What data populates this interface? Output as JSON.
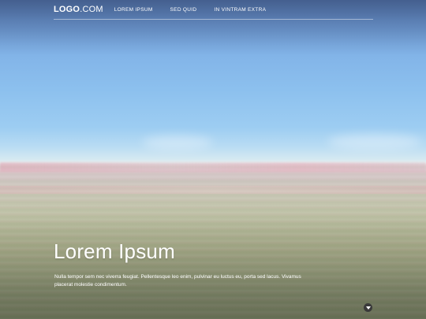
{
  "nav": {
    "logo_bold": "LOGO",
    "logo_light": ".COM",
    "items": [
      {
        "label": "LOREM IPSUM"
      },
      {
        "label": "SED QUID"
      },
      {
        "label": "IN VINTRAM EXTRA"
      }
    ]
  },
  "hero": {
    "title": "Lorem Ipsum",
    "text": "Nulla tempor sem nec viverra feugiat. Pellentesque leo enim, pulvinar eu luctus eu, porta sed lacus. Vivamus placerat molestie condimentum.",
    "scroll_icon": "chevron-down-icon"
  },
  "colors": {
    "text": "#ffffff",
    "scroll_button": "#3a3a3a"
  }
}
